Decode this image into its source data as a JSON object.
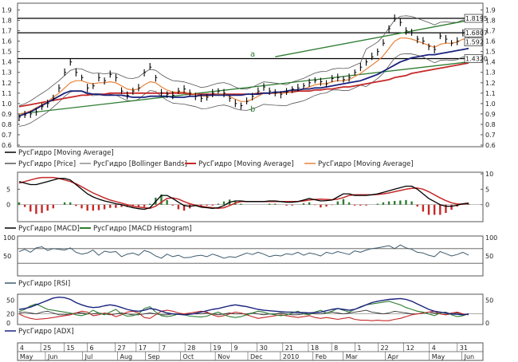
{
  "ticker": "РусГидро",
  "chart_data": [
    {
      "type": "line",
      "name": "price-panel",
      "ylim": [
        0.6,
        1.95
      ],
      "yticks": [
        "0.6",
        "0.7",
        "0.8",
        "0.9",
        "1.0",
        "1.1",
        "1.2",
        "1.3",
        "1.4",
        "1.5",
        "1.6",
        "1.7",
        "1.8",
        "1.9"
      ],
      "hlines": [
        1.8195,
        1.6807,
        1.432
      ],
      "value_labels": [
        "1.8195",
        "1.6807",
        "1.592",
        "1.4320"
      ],
      "value_label_values": [
        1.8195,
        1.6807,
        1.592,
        1.432
      ],
      "annotations": [
        {
          "text": "a"
        },
        {
          "text": "b"
        }
      ],
      "legend": [
        "РусГидро [Moving Average]",
        "РусГидро [Price]",
        "РусГидро [Bollinger Bands]",
        "РусГидро [Moving Average]",
        "РусГидро [Moving Average]"
      ],
      "colors": {
        "price": "#000000",
        "bands": "#555555",
        "ma_long": "#1a237e",
        "ma_red": "#c62828",
        "ma_orange": "#e8833a",
        "trend": "#2e7d32"
      },
      "price": [
        0.87,
        0.89,
        0.9,
        0.92,
        0.97,
        1.0,
        1.05,
        1.15,
        1.3,
        1.4,
        1.3,
        1.25,
        1.15,
        1.17,
        1.25,
        1.22,
        1.28,
        1.25,
        1.12,
        1.08,
        1.12,
        1.15,
        1.3,
        1.35,
        1.25,
        1.1,
        1.09,
        1.08,
        1.12,
        1.14,
        1.1,
        1.07,
        1.05,
        1.06,
        1.1,
        1.12,
        1.1,
        1.05,
        1.0,
        0.98,
        1.02,
        1.07,
        1.12,
        1.16,
        1.12,
        1.1,
        1.09,
        1.11,
        1.14,
        1.15,
        1.17,
        1.2,
        1.22,
        1.21,
        1.19,
        1.24,
        1.25,
        1.23,
        1.25,
        1.3,
        1.35,
        1.4,
        1.45,
        1.5,
        1.58,
        1.72,
        1.82,
        1.78,
        1.7,
        1.68,
        1.62,
        1.6,
        1.55,
        1.52,
        1.65,
        1.62,
        1.58,
        1.6,
        1.68,
        1.6
      ],
      "ma_long": [
        0.88,
        0.9,
        0.92,
        0.95,
        0.98,
        1.01,
        1.04,
        1.07,
        1.1,
        1.12,
        1.12,
        1.12,
        1.1,
        1.09,
        1.09,
        1.08,
        1.08,
        1.08,
        1.08,
        1.07,
        1.06,
        1.06,
        1.06,
        1.07,
        1.07,
        1.07,
        1.07,
        1.06,
        1.06,
        1.06,
        1.07,
        1.07,
        1.08,
        1.08,
        1.08,
        1.08,
        1.08,
        1.08,
        1.08,
        1.08,
        1.09,
        1.09,
        1.09,
        1.1,
        1.1,
        1.11,
        1.11,
        1.12,
        1.13,
        1.13,
        1.14,
        1.14,
        1.15,
        1.15,
        1.16,
        1.17,
        1.18,
        1.19,
        1.2,
        1.21,
        1.22,
        1.24,
        1.26,
        1.28,
        1.31,
        1.34,
        1.37,
        1.4,
        1.42,
        1.44,
        1.45,
        1.46,
        1.47,
        1.47,
        1.48,
        1.49,
        1.5,
        1.51,
        1.52,
        1.53
      ],
      "ma_red": [
        0.97,
        0.98,
        0.99,
        1.0,
        1.01,
        1.02,
        1.03,
        1.04,
        1.05,
        1.06,
        1.07,
        1.08,
        1.08,
        1.09,
        1.09,
        1.09,
        1.1,
        1.1,
        1.1,
        1.1,
        1.1,
        1.1,
        1.1,
        1.1,
        1.1,
        1.1,
        1.1,
        1.1,
        1.1,
        1.1,
        1.09,
        1.09,
        1.09,
        1.09,
        1.09,
        1.09,
        1.09,
        1.09,
        1.09,
        1.09,
        1.09,
        1.09,
        1.1,
        1.1,
        1.1,
        1.1,
        1.11,
        1.11,
        1.11,
        1.12,
        1.12,
        1.12,
        1.13,
        1.13,
        1.14,
        1.14,
        1.15,
        1.16,
        1.16,
        1.17,
        1.18,
        1.19,
        1.2,
        1.21,
        1.22,
        1.23,
        1.25,
        1.26,
        1.27,
        1.29,
        1.3,
        1.31,
        1.32,
        1.33,
        1.34,
        1.35,
        1.36,
        1.37,
        1.38,
        1.39
      ],
      "ma_orange": [
        0.9,
        0.91,
        0.93,
        0.96,
        0.99,
        1.02,
        1.06,
        1.1,
        1.15,
        1.2,
        1.22,
        1.22,
        1.2,
        1.19,
        1.2,
        1.2,
        1.21,
        1.2,
        1.17,
        1.14,
        1.13,
        1.14,
        1.18,
        1.21,
        1.2,
        1.16,
        1.13,
        1.11,
        1.11,
        1.11,
        1.1,
        1.09,
        1.07,
        1.07,
        1.08,
        1.09,
        1.09,
        1.07,
        1.04,
        1.02,
        1.02,
        1.04,
        1.07,
        1.1,
        1.1,
        1.1,
        1.1,
        1.1,
        1.12,
        1.13,
        1.14,
        1.16,
        1.18,
        1.19,
        1.19,
        1.21,
        1.22,
        1.22,
        1.23,
        1.26,
        1.29,
        1.33,
        1.37,
        1.41,
        1.46,
        1.53,
        1.6,
        1.63,
        1.63,
        1.62,
        1.6,
        1.58,
        1.56,
        1.54,
        1.57,
        1.58,
        1.58,
        1.59,
        1.62,
        1.61
      ],
      "trend_a": [
        [
          45,
          1.45
        ],
        [
          79,
          1.8
        ]
      ],
      "trend_low": [
        [
          0,
          0.9
        ],
        [
          79,
          1.4
        ]
      ]
    },
    {
      "type": "line",
      "name": "macd-panel",
      "ylim": [
        -5,
        10
      ],
      "yticks_left": [
        "5",
        "0"
      ],
      "yticks_right": [
        "10",
        "5",
        "0"
      ],
      "legend": [
        "РусГидро [MACD]",
        "РусГидро [MACD Histogram]"
      ],
      "colors": {
        "macd": "#000000",
        "signal": "#c62828",
        "hist_pos": "#2e7d32",
        "hist_neg": "#c62828"
      },
      "macd": [
        7.5,
        7,
        6.5,
        6.5,
        7,
        7.5,
        8,
        8.5,
        8.5,
        8,
        6.5,
        5,
        3.5,
        2.5,
        1.8,
        1.2,
        0.8,
        0.3,
        0,
        -0.5,
        -1,
        -1.3,
        -1.5,
        -1,
        1,
        3,
        3,
        2,
        0.8,
        -0.3,
        -0.5,
        -0.3,
        -0.8,
        -1,
        -1.2,
        -1,
        -0.3,
        0.8,
        1.2,
        1.2,
        1,
        1,
        1,
        1,
        1.2,
        1.2,
        1,
        0.8,
        0.8,
        1,
        1.5,
        2,
        1.6,
        1.2,
        1.3,
        1.5,
        2.5,
        3.5,
        3.5,
        3,
        3,
        3,
        3.2,
        3.5,
        4,
        4.5,
        5,
        5.5,
        6,
        6,
        5,
        3.5,
        2,
        1,
        0,
        -0.5,
        -0.5,
        -0.2,
        0.3,
        0.5
      ],
      "signal": [
        7,
        7.5,
        8,
        8.5,
        8.8,
        8.8,
        8.8,
        8.5,
        8,
        7.5,
        6.8,
        5.8,
        4.8,
        3.8,
        3,
        2.2,
        1.5,
        1,
        0.5,
        0,
        -0.5,
        -0.8,
        -1,
        -1.2,
        -0.5,
        0.8,
        2,
        2.2,
        1.8,
        1,
        0.3,
        -0.2,
        -0.5,
        -0.8,
        -1,
        -1.2,
        -1,
        -0.3,
        0.5,
        1,
        1,
        1,
        1,
        1,
        1,
        1,
        1,
        1,
        1,
        1,
        1.2,
        1.5,
        1.7,
        1.8,
        1.7,
        1.6,
        1.8,
        2.3,
        3,
        3.2,
        3.2,
        3.2,
        3.2,
        3.3,
        3.5,
        3.8,
        4.2,
        4.6,
        5,
        5.3,
        5.4,
        5,
        4.2,
        3.2,
        2.2,
        1.3,
        0.6,
        0.2,
        0.2,
        0.3
      ],
      "histogram": [
        0.5,
        -0.5,
        -1.5,
        -2,
        -1.8,
        -1.3,
        -0.8,
        0,
        0.5,
        0.5,
        -0.3,
        -0.8,
        -1.3,
        -1.3,
        -1.2,
        -1,
        -0.7,
        -0.7,
        -0.5,
        -0.5,
        -0.5,
        -0.5,
        -0.5,
        0.2,
        1.5,
        2.2,
        1,
        -0.2,
        -1,
        -1.3,
        -0.8,
        -0.1,
        -0.3,
        -0.2,
        -0.2,
        0.2,
        0.7,
        1.1,
        0.7,
        0.2,
        0,
        0,
        0,
        0,
        0.2,
        0.2,
        0,
        -0.2,
        -0.2,
        0,
        0.3,
        0.5,
        -0.1,
        -0.6,
        -0.4,
        -0.1,
        0.7,
        1.2,
        0.5,
        -0.2,
        -0.2,
        -0.2,
        0,
        0.2,
        0.5,
        0.7,
        0.8,
        0.9,
        1,
        0.7,
        -0.4,
        -1.5,
        -2.2,
        -2.2,
        -2.2,
        -1.8,
        -1.1,
        -0.4,
        0.1,
        0.2
      ]
    },
    {
      "type": "line",
      "name": "rsi-panel",
      "ylim": [
        0,
        100
      ],
      "yticks_left": [
        "100",
        "50"
      ],
      "yticks_right": [
        "100",
        "50"
      ],
      "hlines": [
        70,
        30
      ],
      "legend": [
        "РусГидро [RSI]"
      ],
      "colors": {
        "rsi": "#3e5b6e"
      },
      "rsi": [
        62,
        68,
        60,
        72,
        75,
        65,
        70,
        68,
        66,
        72,
        60,
        55,
        58,
        66,
        52,
        63,
        60,
        62,
        48,
        55,
        58,
        52,
        65,
        60,
        50,
        44,
        55,
        48,
        52,
        45,
        46,
        50,
        52,
        48,
        55,
        50,
        44,
        48,
        46,
        52,
        58,
        54,
        60,
        55,
        48,
        52,
        50,
        56,
        54,
        60,
        52,
        58,
        55,
        50,
        60,
        56,
        62,
        58,
        54,
        64,
        60,
        66,
        70,
        72,
        75,
        78,
        70,
        80,
        72,
        68,
        60,
        58,
        52,
        48,
        62,
        56,
        50,
        54,
        60,
        52
      ]
    },
    {
      "type": "line",
      "name": "adx-panel",
      "ylim": [
        0,
        60
      ],
      "yticks_left": [
        "50",
        "20",
        "0"
      ],
      "yticks_right": [
        "50",
        "0"
      ],
      "hlines": [
        20
      ],
      "legend": [
        "РусГидро [ADX]"
      ],
      "colors": {
        "adx": "#1a237e",
        "di_plus": "#2e7d32",
        "di_minus": "#c62828",
        "dark": "#333333"
      },
      "adx": [
        30,
        32,
        35,
        40,
        45,
        50,
        55,
        57,
        56,
        52,
        45,
        40,
        36,
        34,
        35,
        38,
        40,
        38,
        34,
        30,
        27,
        26,
        28,
        32,
        30,
        26,
        22,
        20,
        19,
        18,
        19,
        21,
        24,
        27,
        30,
        32,
        35,
        38,
        40,
        38,
        36,
        33,
        30,
        28,
        27,
        26,
        25,
        24,
        24,
        23,
        23,
        22,
        23,
        24,
        27,
        30,
        32,
        30,
        28,
        30,
        35,
        40,
        45,
        48,
        50,
        52,
        53,
        54,
        52,
        48,
        42,
        36,
        30,
        26,
        24,
        22,
        20,
        19,
        18,
        20
      ],
      "di_plus": [
        25,
        30,
        38,
        42,
        36,
        30,
        28,
        26,
        24,
        22,
        18,
        16,
        20,
        28,
        22,
        18,
        24,
        30,
        20,
        15,
        16,
        20,
        32,
        36,
        24,
        16,
        14,
        16,
        20,
        18,
        15,
        14,
        13,
        15,
        20,
        24,
        18,
        14,
        12,
        14,
        18,
        22,
        26,
        24,
        20,
        18,
        16,
        18,
        22,
        26,
        20,
        18,
        24,
        28,
        22,
        26,
        32,
        28,
        24,
        30,
        36,
        40,
        42,
        44,
        46,
        48,
        44,
        40,
        34,
        30,
        26,
        24,
        20,
        16,
        22,
        24,
        18,
        14,
        16,
        20
      ],
      "di_minus": [
        20,
        14,
        10,
        8,
        9,
        10,
        12,
        14,
        16,
        18,
        22,
        26,
        24,
        16,
        18,
        22,
        20,
        14,
        18,
        24,
        26,
        22,
        12,
        10,
        18,
        26,
        28,
        26,
        22,
        20,
        22,
        24,
        26,
        24,
        18,
        14,
        16,
        20,
        24,
        22,
        18,
        14,
        10,
        12,
        14,
        16,
        18,
        16,
        14,
        12,
        14,
        16,
        12,
        10,
        12,
        10,
        8,
        10,
        12,
        8,
        6,
        6,
        5,
        6,
        5,
        5,
        8,
        10,
        14,
        18,
        20,
        22,
        24,
        26,
        20,
        18,
        22,
        24,
        20,
        18
      ],
      "dark": [
        22,
        24,
        22,
        20,
        24,
        26,
        22,
        18,
        18,
        20,
        22,
        22,
        20,
        20,
        22,
        20,
        18,
        20,
        22,
        20,
        18,
        18,
        20,
        22,
        20,
        18,
        18,
        20,
        20,
        20,
        20,
        20,
        20,
        22,
        20,
        18,
        20,
        22,
        20,
        20,
        20,
        22,
        20,
        18,
        20,
        20,
        22,
        20,
        18,
        18,
        20,
        22,
        20,
        20,
        22,
        24,
        22,
        20,
        22,
        24,
        26,
        28,
        24,
        22,
        20,
        22,
        26,
        24,
        22,
        20,
        20,
        22,
        24,
        22,
        20,
        18,
        20,
        22,
        20,
        18
      ]
    }
  ],
  "time_axis": {
    "days": [
      "4",
      "25",
      "15",
      "6",
      "27",
      "17",
      "7",
      "28",
      "19",
      "9",
      "30",
      "21",
      "18",
      "8",
      "1",
      "22",
      "12",
      "4",
      "31"
    ],
    "day_positions": [
      0.5,
      5.5,
      10.5,
      15.5,
      21.5,
      26,
      31,
      36.5,
      42,
      46.5,
      52,
      57.5,
      63,
      68,
      73,
      78,
      83.5,
      89,
      95
    ],
    "months": [
      "May",
      "Jun",
      "Jul",
      "Aug",
      "Sep",
      "Oct",
      "Nov",
      "Dec",
      "2010",
      "Feb",
      "Mar",
      "Apr",
      "May",
      "Jun"
    ],
    "month_positions": [
      0.5,
      6.5,
      14.5,
      22,
      28,
      35.5,
      43,
      50,
      57,
      64,
      70.5,
      79.5,
      89,
      96
    ],
    "span": 100
  }
}
